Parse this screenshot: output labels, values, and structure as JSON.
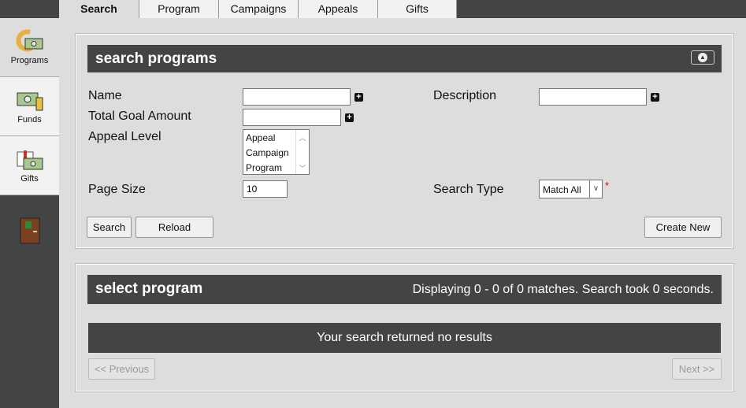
{
  "tabs": [
    "Search",
    "Program",
    "Campaigns",
    "Appeals",
    "Gifts"
  ],
  "sidebar": {
    "items": [
      {
        "label": "Programs",
        "icon": "programs-icon"
      },
      {
        "label": "Funds",
        "icon": "funds-icon"
      },
      {
        "label": "Gifts",
        "icon": "gifts-icon"
      }
    ],
    "exit_icon": "exit-door-icon"
  },
  "search_panel": {
    "title": "search programs",
    "collapse_icon": "collapse-up-icon",
    "fields": {
      "name": "Name",
      "total_goal": "Total Goal Amount",
      "appeal_level": "Appeal Level",
      "page_size": "Page Size",
      "description": "Description",
      "search_type": "Search Type"
    },
    "values": {
      "name": "",
      "total_goal": "",
      "description": "",
      "page_size": "10",
      "search_type": "Match All"
    },
    "appeal_level_options": [
      "Appeal",
      "Campaign",
      "Program"
    ],
    "required_mark": "*",
    "buttons": {
      "search": "Search",
      "reload": "Reload",
      "create_new": "Create New"
    }
  },
  "results_panel": {
    "title": "select program",
    "status": "Displaying 0 - 0 of 0 matches. Search took 0 seconds.",
    "empty": "Your search returned no results",
    "prev": "<< Previous",
    "next": "Next >>"
  }
}
